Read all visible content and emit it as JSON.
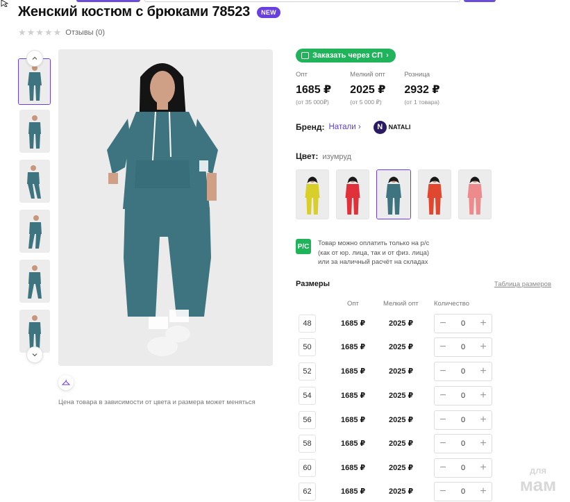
{
  "product": {
    "title": "Женский костюм с брюками 78523",
    "badge": "NEW",
    "reviews": "Отзывы (0)",
    "rating": 0,
    "rating_max": 5,
    "price_note": "Цена товара в зависимости от цвета и размера может меняться"
  },
  "order": {
    "label": "Заказать через СП"
  },
  "prices": [
    {
      "label": "Опт",
      "value": "1685 ₽",
      "sub": "(от 35 000₽)"
    },
    {
      "label": "Мелкий опт",
      "value": "2025 ₽",
      "sub": "(от 5 000 ₽)"
    },
    {
      "label": "Розница",
      "value": "2932 ₽",
      "sub": "(от 1 товара)"
    }
  ],
  "brand": {
    "label": "Бренд:",
    "name": "Натали",
    "logo_text": "NATALI",
    "logo_letter": "N"
  },
  "color": {
    "label": "Цвет:",
    "value": "изумруд",
    "swatches": [
      {
        "name": "yellow",
        "color": "#d9cf2a"
      },
      {
        "name": "red",
        "color": "#e0303a"
      },
      {
        "name": "teal",
        "color": "#3d7480"
      },
      {
        "name": "orange-red",
        "color": "#e0472e"
      },
      {
        "name": "pink",
        "color": "#ec8a8c"
      }
    ],
    "active_index": 2
  },
  "payment": {
    "icon_text": "Р/С",
    "lines": [
      "Товар можно оплатить только на р/с",
      "(как от юр. лица, так и от физ. лица)",
      "или за наличный расчёт на складах"
    ]
  },
  "sizes": {
    "title": "Размеры",
    "table_link": "Таблица размеров",
    "headers": {
      "opt": "Опт",
      "small_opt": "Мелкий опт",
      "qty": "Количество"
    },
    "rows": [
      {
        "size": "48",
        "opt": "1685 ₽",
        "small_opt": "2025 ₽",
        "qty": "0"
      },
      {
        "size": "50",
        "opt": "1685 ₽",
        "small_opt": "2025 ₽",
        "qty": "0"
      },
      {
        "size": "52",
        "opt": "1685 ₽",
        "small_opt": "2025 ₽",
        "qty": "0"
      },
      {
        "size": "54",
        "opt": "1685 ₽",
        "small_opt": "2025 ₽",
        "qty": "0"
      },
      {
        "size": "56",
        "opt": "1685 ₽",
        "small_opt": "2025 ₽",
        "qty": "0"
      },
      {
        "size": "58",
        "opt": "1685 ₽",
        "small_opt": "2025 ₽",
        "qty": "0"
      },
      {
        "size": "60",
        "opt": "1685 ₽",
        "small_opt": "2025 ₽",
        "qty": "0"
      },
      {
        "size": "62",
        "opt": "1685 ₽",
        "small_opt": "2025 ₽",
        "qty": "0"
      }
    ]
  },
  "colors": {
    "accent": "#6a3fe0",
    "green": "#1fb35a",
    "suit": "#3d7480"
  },
  "watermark": {
    "line1": "для",
    "line2": "мам"
  }
}
